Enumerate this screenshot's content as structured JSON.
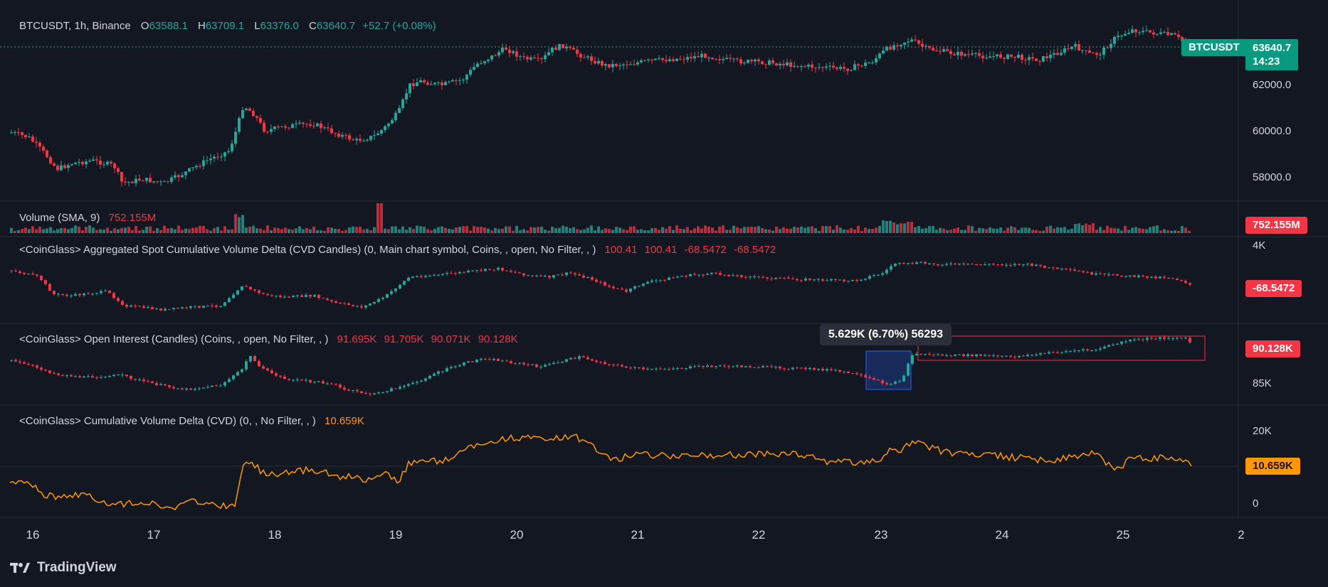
{
  "main": {
    "symbol_text": "BTCUSDT, 1h, Binance",
    "open_label": "O",
    "open": "63588.1",
    "high_label": "H",
    "high": "63709.1",
    "low_label": "L",
    "low": "63376.0",
    "close_label": "C",
    "close": "63640.7",
    "change": "+52.7 (+0.08%)",
    "price_axis": [
      "62000.0",
      "60000.0",
      "58000.0"
    ],
    "last_symbol": "BTCUSDT",
    "last_price": "63640.7",
    "countdown": "14:23"
  },
  "volume": {
    "title": "Volume (SMA, 9)",
    "value": "752.155M",
    "tag": "752.155M"
  },
  "spot_cvd": {
    "title": "<CoinGlass> Aggregated Spot Cumulative Volume Delta (CVD Candles) (0, Main chart symbol, Coins, , open, No Filter, , )",
    "v1": "100.41",
    "v2": "100.41",
    "v3": "-68.5472",
    "v4": "-68.5472",
    "axis_top": "4K",
    "tag": "-68.5472"
  },
  "oi": {
    "title": "<CoinGlass> Open Interest (Candles) (Coins, , open, No Filter, , )",
    "v1": "91.695K",
    "v2": "91.705K",
    "v3": "90.071K",
    "v4": "90.128K",
    "axis": "85K",
    "tag": "90.128K",
    "tooltip": "5.629K (6.70%) 56293"
  },
  "cvd": {
    "title": "<CoinGlass> Cumulative Volume Delta (CVD) (0, , No Filter, , )",
    "value": "10.659K",
    "axis": [
      "20K",
      "0"
    ],
    "tag": "10.659K"
  },
  "time_axis": [
    "16",
    "17",
    "18",
    "19",
    "20",
    "21",
    "22",
    "23",
    "24",
    "25",
    "2"
  ],
  "brand": "TradingView",
  "colors": {
    "up": "#26a69a",
    "down": "#f23645",
    "cvd_line": "#ff9800",
    "bg": "#131722"
  },
  "chart_data": [
    {
      "type": "candlestick",
      "name": "BTCUSDT 1h",
      "x": [
        "16",
        "17",
        "18",
        "19",
        "20",
        "21",
        "22",
        "23",
        "24",
        "25"
      ],
      "close_approx": [
        59800,
        57800,
        60600,
        62300,
        63100,
        62700,
        62900,
        63400,
        63000,
        63640.7
      ],
      "ylim": [
        57000,
        64500
      ]
    },
    {
      "type": "bar",
      "name": "Volume",
      "last": 752155000
    },
    {
      "type": "line",
      "name": "CVD",
      "x": [
        "16",
        "17",
        "18",
        "19",
        "20",
        "21",
        "22",
        "23",
        "24",
        "25"
      ],
      "values": [
        4000,
        0,
        10000,
        12000,
        18000,
        14000,
        14000,
        16000,
        13000,
        10659
      ],
      "ylim": [
        0,
        20000
      ]
    }
  ]
}
